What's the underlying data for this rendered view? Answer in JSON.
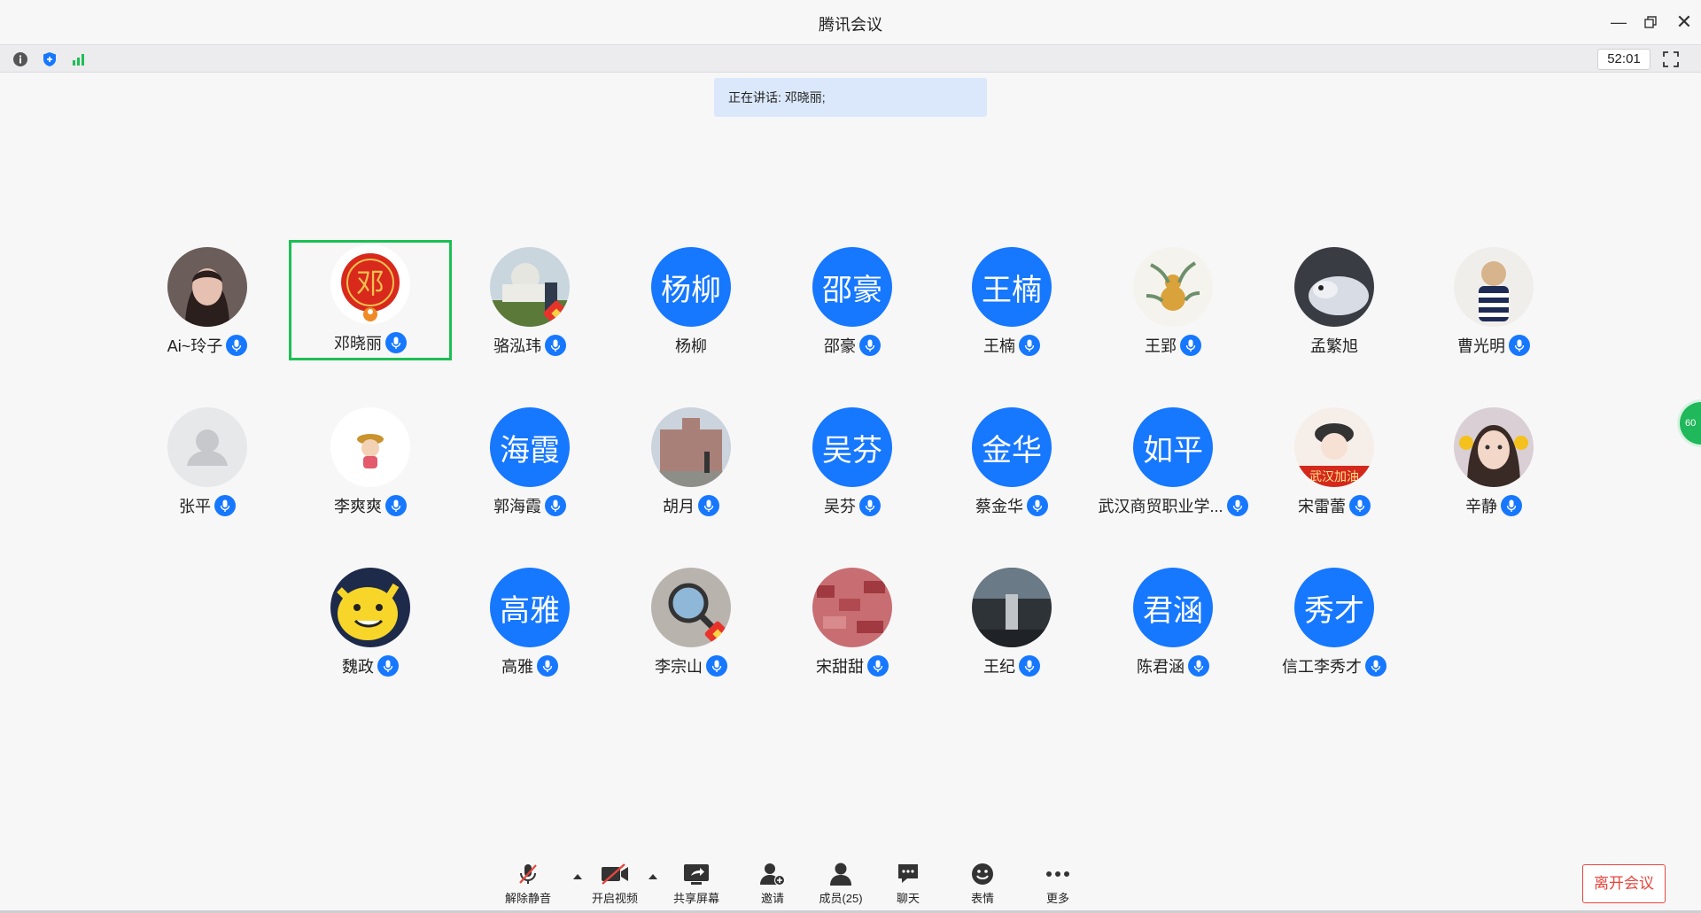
{
  "window": {
    "title": "腾讯会议"
  },
  "toolbar": {
    "timer": "52:01"
  },
  "speaking": {
    "label": "正在讲话:",
    "speaker": "邓晓丽;"
  },
  "participants": [
    {
      "name": "Ai~玲子",
      "avatar": "photo",
      "icon": "woman-portrait",
      "active": false
    },
    {
      "name": "邓晓丽",
      "avatar": "photo",
      "icon": "deng-seal-avatar",
      "active": true
    },
    {
      "name": "骆泓玮",
      "avatar": "photo",
      "icon": "capitol-building",
      "active": false,
      "flag": true
    },
    {
      "name": "杨柳",
      "avatar": "text",
      "avatar_text": "杨柳",
      "mic": false
    },
    {
      "name": "邵豪",
      "avatar": "text",
      "avatar_text": "邵豪"
    },
    {
      "name": "王楠",
      "avatar": "text",
      "avatar_text": "王楠"
    },
    {
      "name": "王郢",
      "avatar": "photo",
      "icon": "gourd-plant"
    },
    {
      "name": "孟繁旭",
      "avatar": "photo",
      "icon": "cat-photo",
      "mic": false
    },
    {
      "name": "曹光明",
      "avatar": "photo",
      "icon": "plush-doll"
    },
    {
      "name": "张平",
      "avatar": "default",
      "icon": "default-user"
    },
    {
      "name": "李爽爽",
      "avatar": "photo",
      "icon": "cartoon-girl"
    },
    {
      "name": "郭海霞",
      "avatar": "text",
      "avatar_text": "海霞"
    },
    {
      "name": "胡月",
      "avatar": "photo",
      "icon": "castle-photo"
    },
    {
      "name": "吴芬",
      "avatar": "text",
      "avatar_text": "吴芬"
    },
    {
      "name": "蔡金华",
      "avatar": "text",
      "avatar_text": "金华"
    },
    {
      "name": "武汉商贸职业学...",
      "avatar": "text",
      "avatar_text": "如平"
    },
    {
      "name": "宋雷蕾",
      "avatar": "photo",
      "icon": "wuhan-girl"
    },
    {
      "name": "辛静",
      "avatar": "photo",
      "icon": "woman-face"
    },
    {
      "name": "魏政",
      "avatar": "photo",
      "icon": "pikachu"
    },
    {
      "name": "高雅",
      "avatar": "text",
      "avatar_text": "高雅"
    },
    {
      "name": "李宗山",
      "avatar": "photo",
      "icon": "magnifier-photo",
      "flag": true
    },
    {
      "name": "宋甜甜",
      "avatar": "photo",
      "icon": "red-town"
    },
    {
      "name": "王纪",
      "avatar": "photo",
      "icon": "street-photo"
    },
    {
      "name": "陈君涵",
      "avatar": "text",
      "avatar_text": "君涵"
    },
    {
      "name": "信工李秀才",
      "avatar": "text",
      "avatar_text": "秀才"
    }
  ],
  "side_bubble": {
    "text": "60"
  },
  "bottom": {
    "unmute": "解除静音",
    "video": "开启视频",
    "share": "共享屏幕",
    "invite": "邀请",
    "members": "成员(25)",
    "chat": "聊天",
    "emoji": "表情",
    "more": "更多",
    "leave": "离开会议"
  },
  "colors": {
    "accent": "#1677ff",
    "active_border": "#1dbf54",
    "leave": "#e8453c"
  }
}
